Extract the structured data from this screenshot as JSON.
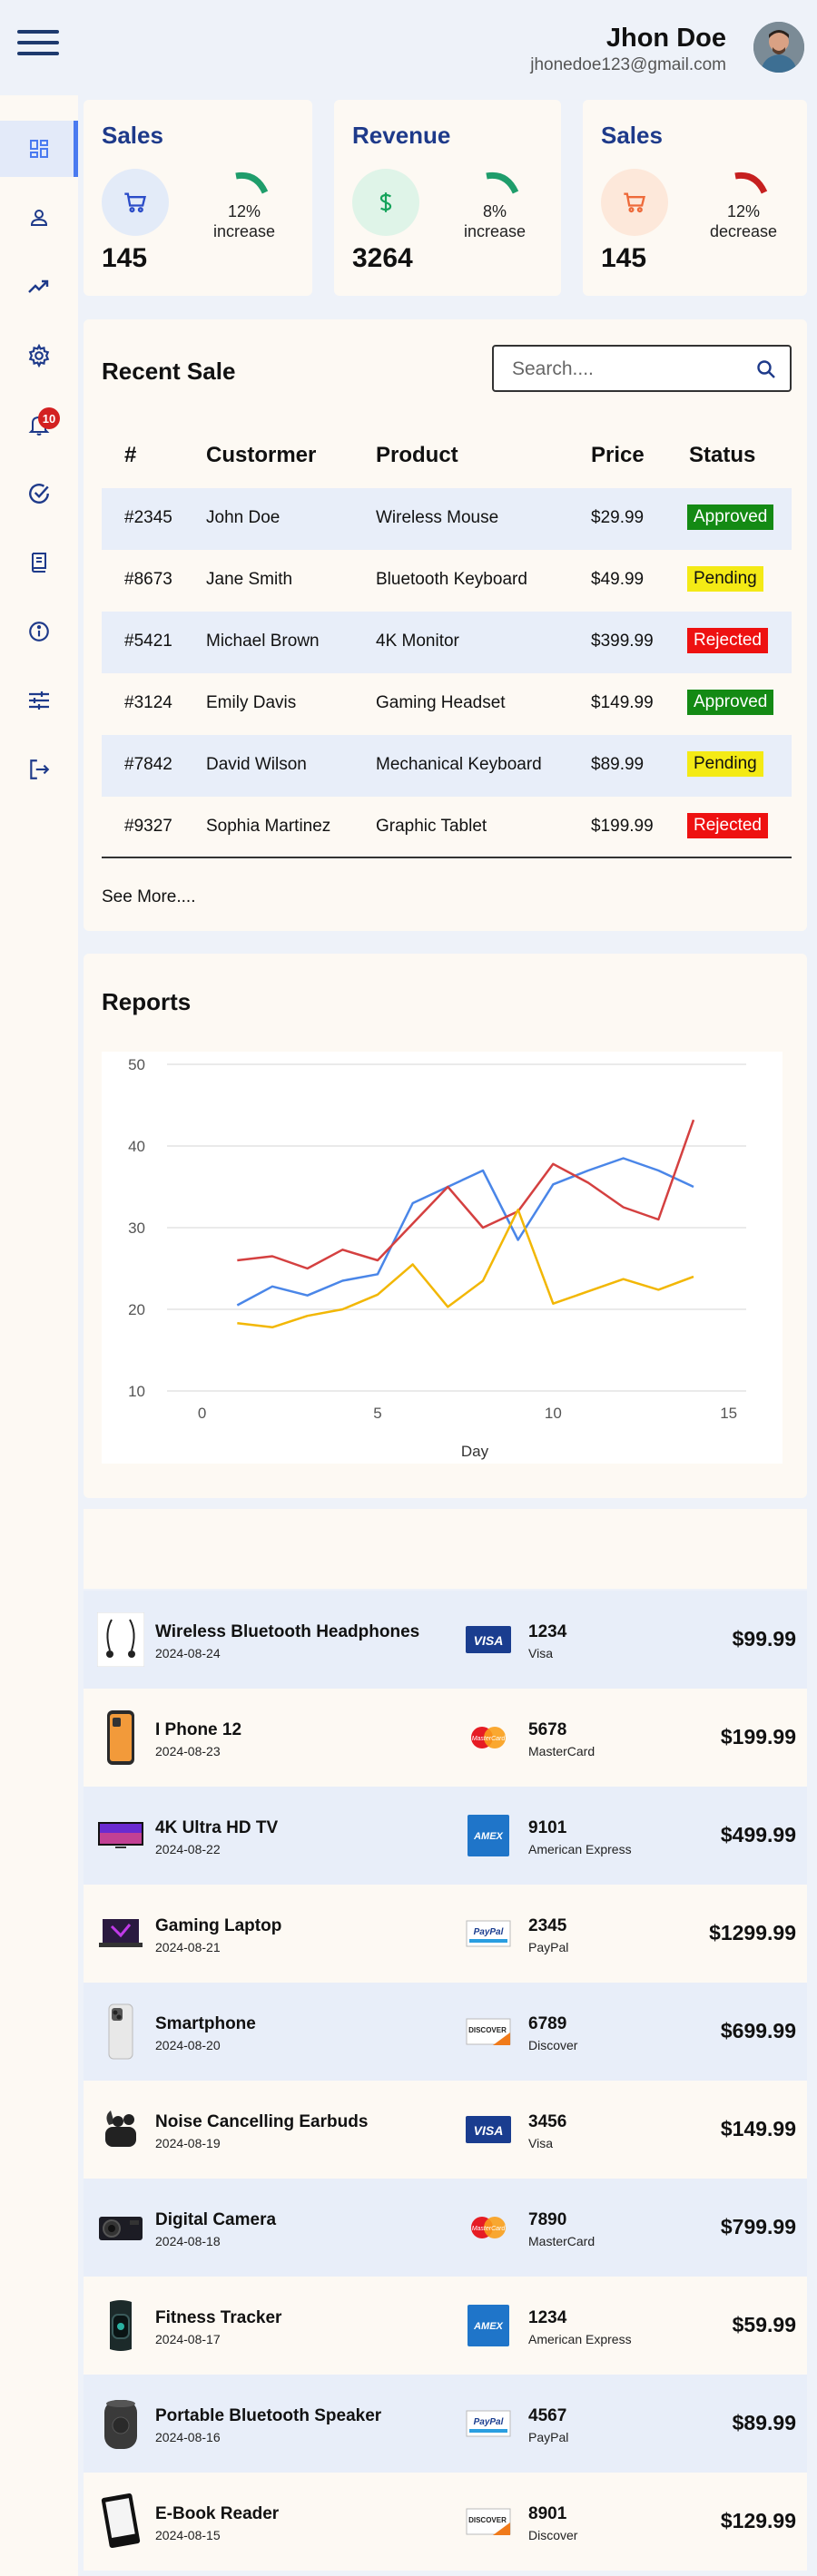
{
  "header": {
    "user_name": "Jhon Doe",
    "user_email": "jhonedoe123@gmail.com"
  },
  "sidebar": {
    "items": [
      {
        "icon": "dashboard-icon",
        "active": true
      },
      {
        "icon": "user-icon"
      },
      {
        "icon": "trending-up-icon"
      },
      {
        "icon": "gear-icon"
      },
      {
        "icon": "bell-icon",
        "badge": "10"
      },
      {
        "icon": "check-circle-icon"
      },
      {
        "icon": "book-icon"
      },
      {
        "icon": "info-icon"
      },
      {
        "icon": "sliders-icon"
      },
      {
        "icon": "logout-icon"
      }
    ]
  },
  "stats": [
    {
      "title": "Sales",
      "value": "145",
      "pct_line1": "12%",
      "pct_line2": "increase",
      "icon": "cart-icon",
      "color": "#1f9d6b",
      "circle_bg": "#e3ebf8",
      "icon_color": "#2b4cc8"
    },
    {
      "title": "Revenue",
      "value": "3264",
      "pct_line1": "8%",
      "pct_line2": "increase",
      "icon": "dollar-icon",
      "color": "#1f9d6b",
      "circle_bg": "#dff4e8",
      "icon_color": "#14a35a"
    },
    {
      "title": "Sales",
      "value": "145",
      "pct_line1": "12%",
      "pct_line2": "decrease",
      "icon": "cart-icon",
      "color": "#c62020",
      "circle_bg": "#fde8da",
      "icon_color": "#ee6a3a"
    }
  ],
  "recent_sale": {
    "title": "Recent Sale",
    "search_placeholder": "Search....",
    "headers": [
      "#",
      "Custormer",
      "Product",
      "Price",
      "Status"
    ],
    "rows": [
      {
        "id": "#2345",
        "customer": "John Doe",
        "product": "Wireless Mouse",
        "price": "$29.99",
        "status": "Approved"
      },
      {
        "id": "#8673",
        "customer": "Jane Smith",
        "product": "Bluetooth Keyboard",
        "price": "$49.99",
        "status": "Pending"
      },
      {
        "id": "#5421",
        "customer": "Michael Brown",
        "product": "4K Monitor",
        "price": "$399.99",
        "status": "Rejected"
      },
      {
        "id": "#3124",
        "customer": "Emily Davis",
        "product": "Gaming Headset",
        "price": "$149.99",
        "status": "Approved"
      },
      {
        "id": "#7842",
        "customer": "David Wilson",
        "product": "Mechanical Keyboard",
        "price": "$89.99",
        "status": "Pending"
      },
      {
        "id": "#9327",
        "customer": "Sophia Martinez",
        "product": "Graphic Tablet",
        "price": "$199.99",
        "status": "Rejected"
      }
    ],
    "see_more": "See More...."
  },
  "reports": {
    "title": "Reports"
  },
  "chart_data": {
    "type": "line",
    "xlabel": "Day",
    "ylabel": "",
    "xlim": [
      -1,
      15.5
    ],
    "ylim": [
      10,
      50
    ],
    "xticks": [
      0,
      5,
      10,
      15
    ],
    "yticks": [
      10,
      20,
      30,
      40,
      50
    ],
    "grid": "horizontal",
    "x": [
      1,
      2,
      3,
      4,
      5,
      6,
      7,
      8,
      9,
      10,
      11,
      12,
      13,
      14
    ],
    "series": [
      {
        "color": "#4a86e8",
        "values": [
          20.5,
          22.8,
          21.7,
          23.5,
          24.3,
          33,
          35,
          37,
          28.5,
          35.3,
          37,
          38.5,
          37,
          35
        ]
      },
      {
        "color": "#d44040",
        "values": [
          26,
          26.5,
          25,
          27.3,
          26,
          30.5,
          35,
          30,
          32,
          37.8,
          35.5,
          32.5,
          31,
          43.2
        ]
      },
      {
        "color": "#f2b705",
        "values": [
          18.3,
          17.8,
          19.2,
          20,
          21.8,
          25.5,
          20.3,
          23.5,
          32.2,
          20.7,
          22.2,
          23.7,
          22.4,
          24
        ]
      }
    ]
  },
  "transactions": [
    {
      "name": "Wireless Bluetooth Headphones",
      "date": "2024-08-24",
      "card_brand": "Visa",
      "card_num": "1234",
      "amount": "$99.99",
      "product_icon": "headphones-icon",
      "card_icon": "visa-icon"
    },
    {
      "name": "I Phone 12",
      "date": "2024-08-23",
      "card_brand": "MasterCard",
      "card_num": "5678",
      "amount": "$199.99",
      "product_icon": "phone-icon",
      "card_icon": "mastercard-icon"
    },
    {
      "name": "4K Ultra HD TV",
      "date": "2024-08-22",
      "card_brand": "American Express",
      "card_num": "9101",
      "amount": "$499.99",
      "product_icon": "tv-icon",
      "card_icon": "amex-icon"
    },
    {
      "name": "Gaming Laptop",
      "date": "2024-08-21",
      "card_brand": "PayPal",
      "card_num": "2345",
      "amount": "$1299.99",
      "product_icon": "laptop-icon",
      "card_icon": "paypal-icon"
    },
    {
      "name": "Smartphone",
      "date": "2024-08-20",
      "card_brand": "Discover",
      "card_num": "6789",
      "amount": "$699.99",
      "product_icon": "smartphone-icon",
      "card_icon": "discover-icon"
    },
    {
      "name": "Noise Cancelling Earbuds",
      "date": "2024-08-19",
      "card_brand": "Visa",
      "card_num": "3456",
      "amount": "$149.99",
      "product_icon": "earbuds-icon",
      "card_icon": "visa-icon"
    },
    {
      "name": "Digital Camera",
      "date": "2024-08-18",
      "card_brand": "MasterCard",
      "card_num": "7890",
      "amount": "$799.99",
      "product_icon": "camera-icon",
      "card_icon": "mastercard-icon"
    },
    {
      "name": "Fitness Tracker",
      "date": "2024-08-17",
      "card_brand": "American Express",
      "card_num": "1234",
      "amount": "$59.99",
      "product_icon": "watch-icon",
      "card_icon": "amex-icon"
    },
    {
      "name": "Portable Bluetooth Speaker",
      "date": "2024-08-16",
      "card_brand": "PayPal",
      "card_num": "4567",
      "amount": "$89.99",
      "product_icon": "speaker-icon",
      "card_icon": "paypal-icon"
    },
    {
      "name": "E-Book Reader",
      "date": "2024-08-15",
      "card_brand": "Discover",
      "card_num": "8901",
      "amount": "$129.99",
      "product_icon": "ebook-icon",
      "card_icon": "discover-icon"
    }
  ]
}
